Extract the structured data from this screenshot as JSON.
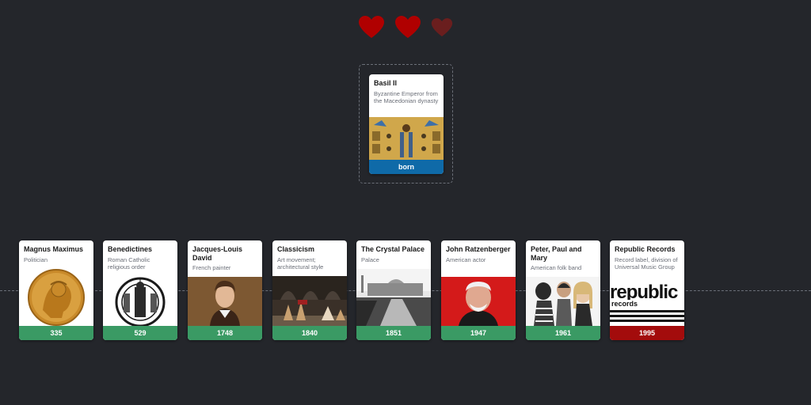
{
  "colors": {
    "background": "#24262b",
    "heart_full": "#b00000",
    "heart_empty": "#6a1e1e",
    "foot_correct": "#3a9a64",
    "foot_wrong": "#a30c0c",
    "foot_active": "#0f6aa8"
  },
  "lives": [
    {
      "icon": "heart-icon",
      "state": "full"
    },
    {
      "icon": "heart-icon",
      "state": "full"
    },
    {
      "icon": "heart-icon",
      "state": "empty"
    }
  ],
  "active_card": {
    "title": "Basil II",
    "description": "Byzantine Emperor from the Macedonian dynasty",
    "label": "born"
  },
  "timeline": [
    {
      "title": "Magnus Maximus",
      "description": "Politician",
      "year": "335"
    },
    {
      "title": "Benedictines",
      "description": "Roman Catholic religious order",
      "year": "529"
    },
    {
      "title": "Jacques-Louis David",
      "description": "French painter",
      "year": "1748"
    },
    {
      "title": "Classicism",
      "description": "Art movement; architectural style",
      "year": "1840"
    },
    {
      "title": "The Crystal Palace",
      "description": "Palace",
      "year": "1851"
    },
    {
      "title": "John Ratzenberger",
      "description": "American actor",
      "year": "1947"
    },
    {
      "title": "Peter, Paul and Mary",
      "description": "American folk band",
      "year": "1961"
    },
    {
      "title": "Republic Records",
      "description": "Record label, division of Universal Music Group",
      "year": "1995",
      "image_text_top": "republic",
      "image_text_bottom": "records"
    }
  ]
}
